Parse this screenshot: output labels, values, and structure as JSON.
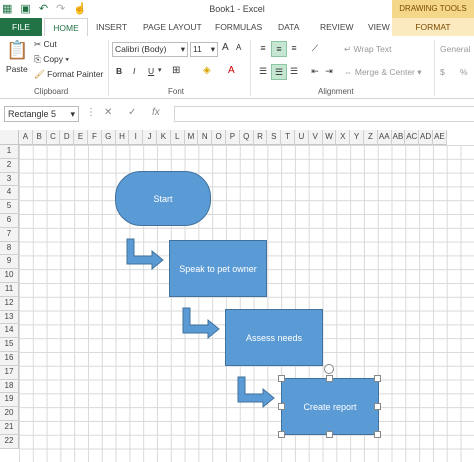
{
  "window": {
    "title": "Book1 - Excel",
    "contextual_group": "DRAWING TOOLS"
  },
  "qat": {
    "save_icon": "save-icon",
    "undo_icon": "undo-icon",
    "redo_icon": "redo-icon"
  },
  "tabs": [
    "FILE",
    "HOME",
    "INSERT",
    "PAGE LAYOUT",
    "FORMULAS",
    "DATA",
    "REVIEW",
    "VIEW",
    "FORMAT"
  ],
  "ribbon": {
    "clipboard": {
      "paste": "Paste",
      "cut": "Cut",
      "copy": "Copy",
      "format_painter": "Format Painter",
      "label": "Clipboard"
    },
    "font": {
      "name": "Calibri (Body)",
      "size": "11",
      "bold": "B",
      "italic": "I",
      "underline": "U",
      "label": "Font",
      "grow": "A",
      "shrink": "A"
    },
    "alignment": {
      "wrap": "Wrap Text",
      "merge": "Merge & Center",
      "label": "Alignment"
    },
    "number": {
      "format": "General",
      "currency": "$",
      "percent": "%"
    }
  },
  "formula_bar": {
    "name_box": "Rectangle 5",
    "fx": "fx",
    "value": ""
  },
  "columns": [
    "A",
    "B",
    "C",
    "D",
    "E",
    "F",
    "G",
    "H",
    "I",
    "J",
    "K",
    "L",
    "M",
    "N",
    "O",
    "P",
    "Q",
    "R",
    "S",
    "T",
    "U",
    "V",
    "W",
    "X",
    "Y",
    "Z",
    "AA",
    "AB",
    "AC",
    "AD",
    "AE"
  ],
  "rows": [
    "1",
    "2",
    "3",
    "4",
    "5",
    "6",
    "7",
    "8",
    "9",
    "10",
    "11",
    "12",
    "13",
    "14",
    "15",
    "16",
    "17",
    "18",
    "19",
    "20",
    "21",
    "22"
  ],
  "shapes": {
    "start": "Start",
    "step1": "Speak to pet owner",
    "step2": "Assess needs",
    "step3": "Create report"
  },
  "colors": {
    "excel_green": "#217346",
    "shape_fill": "#5b9bd5",
    "shape_border": "#41719c"
  }
}
